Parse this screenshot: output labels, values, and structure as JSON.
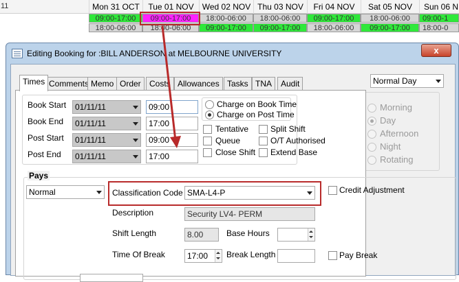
{
  "roster": {
    "left_fragment": "11",
    "days": [
      "Mon 31 OCT",
      "Tue 01 NOV",
      "Wed 02 NOV",
      "Thu 03 NOV",
      "Fri 04 NOV",
      "Sat 05 NOV",
      "Sun 06 N"
    ],
    "row1": [
      "09:00-17:00",
      "09:00-17:00",
      "18:00-06:00",
      "18:00-06:00",
      "09:00-17:00",
      "18:00-06:00",
      "09:00-1"
    ],
    "row2": [
      "18:00-06:00",
      "18:00-06:00",
      "09:00-17:00",
      "09:00-17:00",
      "18:00-06:00",
      "09:00-17:00",
      "18:00-0"
    ],
    "colors": {
      "green": "#2fe83a",
      "grey": "#d6d6d6",
      "magenta": "#ff22ff",
      "highlight": "#b82a2a"
    }
  },
  "dialog": {
    "title": "Editing Booking for :BILL ANDERSON at MELBOURNE UNIVERSITY",
    "close_label": "x",
    "tabs": [
      "Times",
      "Comments",
      "Memo",
      "Order",
      "Costs",
      "Allowances",
      "Tasks",
      "TNA",
      "Audit"
    ],
    "day_type": "Normal Day",
    "times": {
      "book_start_label": "Book Start",
      "book_start_date": "01/11/11",
      "book_start_time": "09:00",
      "book_end_label": "Book End",
      "book_end_date": "01/11/11",
      "book_end_time": "17:00",
      "post_start_label": "Post Start",
      "post_start_date": "01/11/11",
      "post_start_time": "09:00",
      "post_end_label": "Post End",
      "post_end_date": "01/11/11",
      "post_end_time": "17:00"
    },
    "charge": {
      "on_book_label": "Charge on Book Time",
      "on_post_label": "Charge on Post Time"
    },
    "checks": {
      "tentative": "Tentative",
      "split_shift": "Split Shift",
      "queue": "Queue",
      "ot_authorised": "O/T Authorised",
      "close_shift": "Close Shift",
      "extend_base": "Extend Base"
    },
    "shift_period": [
      "Morning",
      "Day",
      "Afternoon",
      "Night",
      "Rotating"
    ],
    "pays": {
      "title": "Pays",
      "pay_type": "Normal",
      "classification_label": "Classification Code",
      "classification_value": "SMA-L4-P",
      "credit_adjustment": "Credit Adjustment",
      "description_label": "Description",
      "description_value": "Security  LV4- PERM",
      "shift_length_label": "Shift Length",
      "shift_length_value": "8.00",
      "base_hours_label": "Base Hours",
      "time_of_break_label": "Time Of Break",
      "time_of_break_value": "17:00",
      "break_length_label": "Break Length",
      "pay_break": "Pay Break"
    }
  }
}
